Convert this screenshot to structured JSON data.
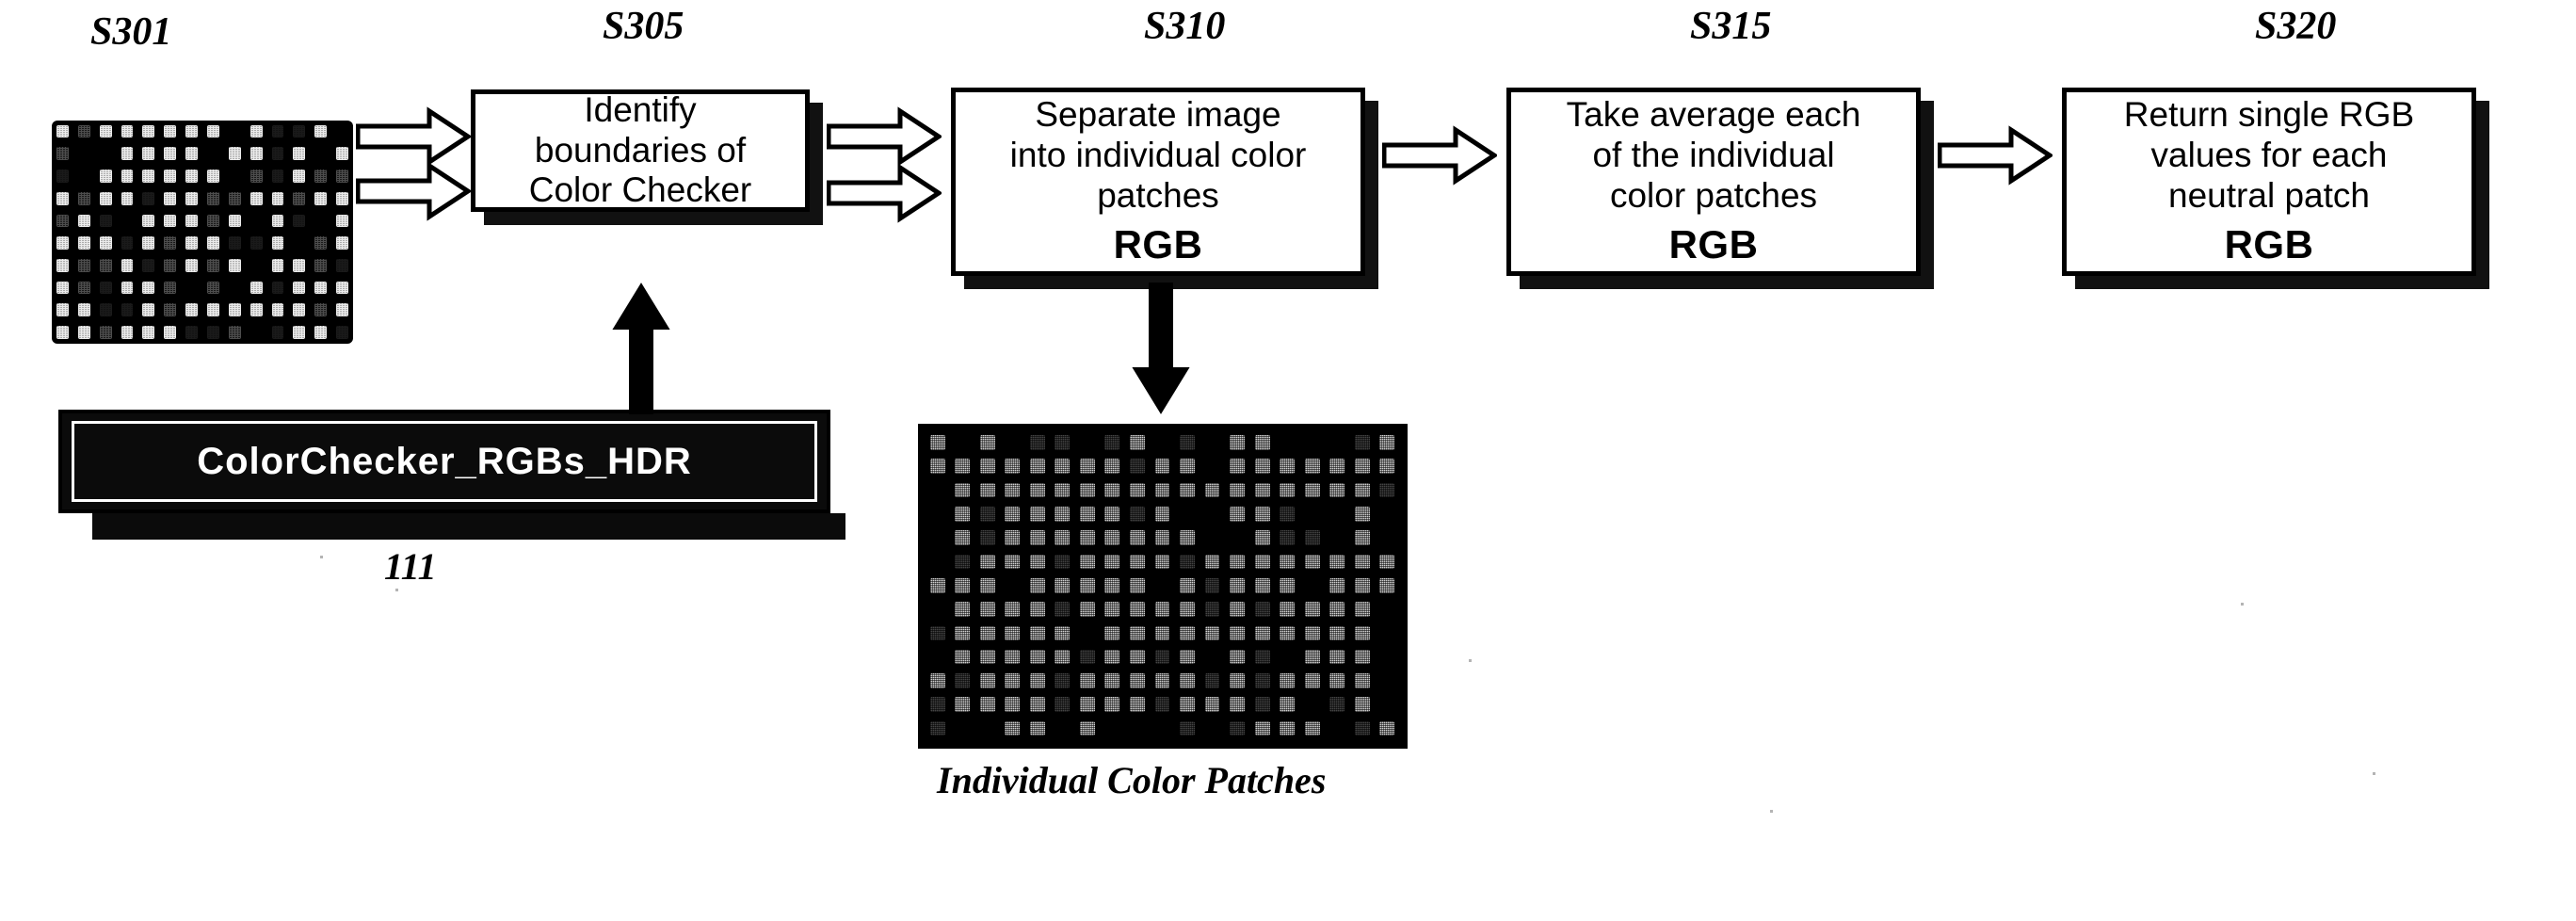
{
  "diagram": {
    "title": "ColorChecker RGB extraction flowchart",
    "step_labels": [
      {
        "id": "s301",
        "text": "S301"
      },
      {
        "id": "s305",
        "text": "S305"
      },
      {
        "id": "s310",
        "text": "S310"
      },
      {
        "id": "s315",
        "text": "S315"
      },
      {
        "id": "s320",
        "text": "S320"
      }
    ],
    "boxes": [
      {
        "id": "s305",
        "lines": [
          "Identify",
          "boundaries of",
          "Color Checker"
        ],
        "rgb": ""
      },
      {
        "id": "s310",
        "lines": [
          "Separate image",
          "into individual color",
          "patches"
        ],
        "rgb": "RGB"
      },
      {
        "id": "s315",
        "lines": [
          "Take average each",
          "of the individual",
          "color patches"
        ],
        "rgb": "RGB"
      },
      {
        "id": "s320",
        "lines": [
          "Return single RGB",
          "values for each",
          "neutral patch"
        ],
        "rgb": "RGB"
      }
    ],
    "file_bar": {
      "filename": "ColorChecker_RGBs_HDR",
      "ref_number": "111"
    },
    "patches": {
      "caption": "Individual Color Patches"
    },
    "colors": {
      "ink": "#000000",
      "paper": "#ffffff",
      "shadow": "#111111",
      "bar_fill": "#0b0b0b",
      "bar_text": "#ffffff"
    },
    "icons": {
      "arrow": "block-arrow-right-icon",
      "arrow_down": "block-arrow-down-icon",
      "arrow_up": "block-arrow-up-icon",
      "source_image": "colorchecker-chart-image",
      "patch_image": "individual-color-patches-image"
    }
  }
}
